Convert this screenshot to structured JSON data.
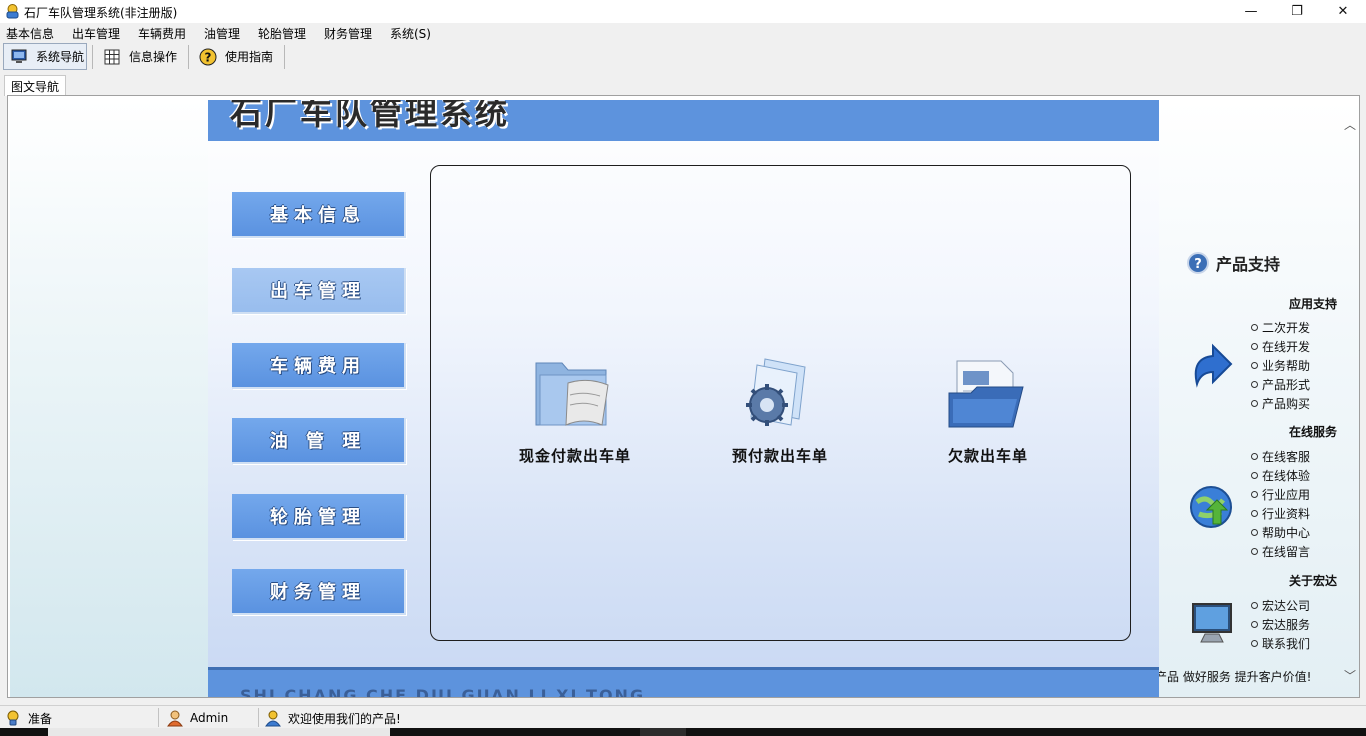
{
  "window": {
    "title": "石厂车队管理系统(非注册版)",
    "minimize_glyph": "—",
    "maximize_glyph": "❐",
    "close_glyph": "✕"
  },
  "menu": [
    "基本信息",
    "出车管理",
    "车辆费用",
    "油管理",
    "轮胎管理",
    "财务管理",
    "系统(S)"
  ],
  "toolbar": {
    "nav_label": "系统导航",
    "ops_label": "信息操作",
    "guide_label": "使用指南"
  },
  "tabs": {
    "active": "图文导航"
  },
  "header": {
    "title": "石厂车队管理系统"
  },
  "nav_buttons": [
    "基本信息",
    "出车管理",
    "车辆费用",
    "油 管 理",
    "轮胎管理",
    "财务管理"
  ],
  "functions": [
    {
      "label": "现金付款出车单",
      "icon": "folder-scroll-icon"
    },
    {
      "label": "预付款出车单",
      "icon": "gear-document-icon"
    },
    {
      "label": "欠款出车单",
      "icon": "open-folder-icon"
    }
  ],
  "footer": {
    "pinyin": "SHI CHANG CHE DUI GUAN LI XI TONG"
  },
  "support": {
    "title": "产品支持",
    "groups": [
      {
        "title": "应用支持",
        "icon": "arrow-icon",
        "links": [
          "二次开发",
          "在线开发",
          "业务帮助",
          "产品形式",
          "产品购买"
        ]
      },
      {
        "title": "在线服务",
        "icon": "globe-icon",
        "links": [
          "在线客服",
          "在线体验",
          "行业应用",
          "行业资料",
          "帮助中心",
          "在线留言"
        ]
      },
      {
        "title": "关于宏达",
        "icon": "monitor-icon",
        "links": [
          "宏达公司",
          "宏达服务",
          "联系我们"
        ]
      }
    ],
    "slogan": "产品  做好服务  提升客户价值!"
  },
  "status": {
    "ready": "准备",
    "user": "Admin",
    "message": "欢迎使用我们的产品!"
  },
  "colors": {
    "header_blue": "#5d93dd",
    "button_blue": "#5a92e0",
    "highlight_button": "#a8c8f2"
  }
}
